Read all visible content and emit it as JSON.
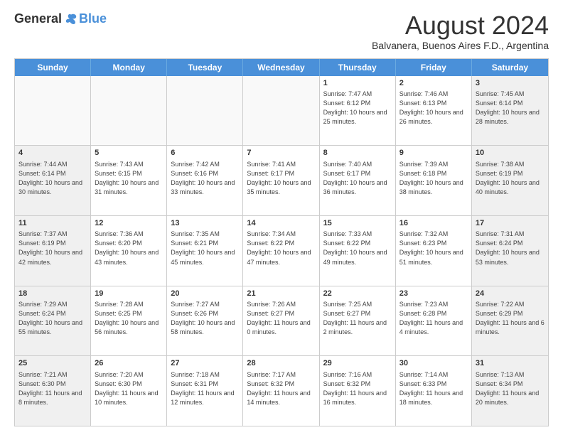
{
  "header": {
    "logo_general": "General",
    "logo_blue": "Blue",
    "title": "August 2024",
    "subtitle": "Balvanera, Buenos Aires F.D., Argentina"
  },
  "days_of_week": [
    "Sunday",
    "Monday",
    "Tuesday",
    "Wednesday",
    "Thursday",
    "Friday",
    "Saturday"
  ],
  "rows": [
    [
      {
        "day": "",
        "info": "",
        "empty": true
      },
      {
        "day": "",
        "info": "",
        "empty": true
      },
      {
        "day": "",
        "info": "",
        "empty": true
      },
      {
        "day": "",
        "info": "",
        "empty": true
      },
      {
        "day": "1",
        "info": "Sunrise: 7:47 AM\nSunset: 6:12 PM\nDaylight: 10 hours\nand 25 minutes."
      },
      {
        "day": "2",
        "info": "Sunrise: 7:46 AM\nSunset: 6:13 PM\nDaylight: 10 hours\nand 26 minutes."
      },
      {
        "day": "3",
        "info": "Sunrise: 7:45 AM\nSunset: 6:14 PM\nDaylight: 10 hours\nand 28 minutes."
      }
    ],
    [
      {
        "day": "4",
        "info": "Sunrise: 7:44 AM\nSunset: 6:14 PM\nDaylight: 10 hours\nand 30 minutes."
      },
      {
        "day": "5",
        "info": "Sunrise: 7:43 AM\nSunset: 6:15 PM\nDaylight: 10 hours\nand 31 minutes."
      },
      {
        "day": "6",
        "info": "Sunrise: 7:42 AM\nSunset: 6:16 PM\nDaylight: 10 hours\nand 33 minutes."
      },
      {
        "day": "7",
        "info": "Sunrise: 7:41 AM\nSunset: 6:17 PM\nDaylight: 10 hours\nand 35 minutes."
      },
      {
        "day": "8",
        "info": "Sunrise: 7:40 AM\nSunset: 6:17 PM\nDaylight: 10 hours\nand 36 minutes."
      },
      {
        "day": "9",
        "info": "Sunrise: 7:39 AM\nSunset: 6:18 PM\nDaylight: 10 hours\nand 38 minutes."
      },
      {
        "day": "10",
        "info": "Sunrise: 7:38 AM\nSunset: 6:19 PM\nDaylight: 10 hours\nand 40 minutes."
      }
    ],
    [
      {
        "day": "11",
        "info": "Sunrise: 7:37 AM\nSunset: 6:19 PM\nDaylight: 10 hours\nand 42 minutes."
      },
      {
        "day": "12",
        "info": "Sunrise: 7:36 AM\nSunset: 6:20 PM\nDaylight: 10 hours\nand 43 minutes."
      },
      {
        "day": "13",
        "info": "Sunrise: 7:35 AM\nSunset: 6:21 PM\nDaylight: 10 hours\nand 45 minutes."
      },
      {
        "day": "14",
        "info": "Sunrise: 7:34 AM\nSunset: 6:22 PM\nDaylight: 10 hours\nand 47 minutes."
      },
      {
        "day": "15",
        "info": "Sunrise: 7:33 AM\nSunset: 6:22 PM\nDaylight: 10 hours\nand 49 minutes."
      },
      {
        "day": "16",
        "info": "Sunrise: 7:32 AM\nSunset: 6:23 PM\nDaylight: 10 hours\nand 51 minutes."
      },
      {
        "day": "17",
        "info": "Sunrise: 7:31 AM\nSunset: 6:24 PM\nDaylight: 10 hours\nand 53 minutes."
      }
    ],
    [
      {
        "day": "18",
        "info": "Sunrise: 7:29 AM\nSunset: 6:24 PM\nDaylight: 10 hours\nand 55 minutes."
      },
      {
        "day": "19",
        "info": "Sunrise: 7:28 AM\nSunset: 6:25 PM\nDaylight: 10 hours\nand 56 minutes."
      },
      {
        "day": "20",
        "info": "Sunrise: 7:27 AM\nSunset: 6:26 PM\nDaylight: 10 hours\nand 58 minutes."
      },
      {
        "day": "21",
        "info": "Sunrise: 7:26 AM\nSunset: 6:27 PM\nDaylight: 11 hours\nand 0 minutes."
      },
      {
        "day": "22",
        "info": "Sunrise: 7:25 AM\nSunset: 6:27 PM\nDaylight: 11 hours\nand 2 minutes."
      },
      {
        "day": "23",
        "info": "Sunrise: 7:23 AM\nSunset: 6:28 PM\nDaylight: 11 hours\nand 4 minutes."
      },
      {
        "day": "24",
        "info": "Sunrise: 7:22 AM\nSunset: 6:29 PM\nDaylight: 11 hours\nand 6 minutes."
      }
    ],
    [
      {
        "day": "25",
        "info": "Sunrise: 7:21 AM\nSunset: 6:30 PM\nDaylight: 11 hours\nand 8 minutes."
      },
      {
        "day": "26",
        "info": "Sunrise: 7:20 AM\nSunset: 6:30 PM\nDaylight: 11 hours\nand 10 minutes."
      },
      {
        "day": "27",
        "info": "Sunrise: 7:18 AM\nSunset: 6:31 PM\nDaylight: 11 hours\nand 12 minutes."
      },
      {
        "day": "28",
        "info": "Sunrise: 7:17 AM\nSunset: 6:32 PM\nDaylight: 11 hours\nand 14 minutes."
      },
      {
        "day": "29",
        "info": "Sunrise: 7:16 AM\nSunset: 6:32 PM\nDaylight: 11 hours\nand 16 minutes."
      },
      {
        "day": "30",
        "info": "Sunrise: 7:14 AM\nSunset: 6:33 PM\nDaylight: 11 hours\nand 18 minutes."
      },
      {
        "day": "31",
        "info": "Sunrise: 7:13 AM\nSunset: 6:34 PM\nDaylight: 11 hours\nand 20 minutes."
      }
    ]
  ]
}
